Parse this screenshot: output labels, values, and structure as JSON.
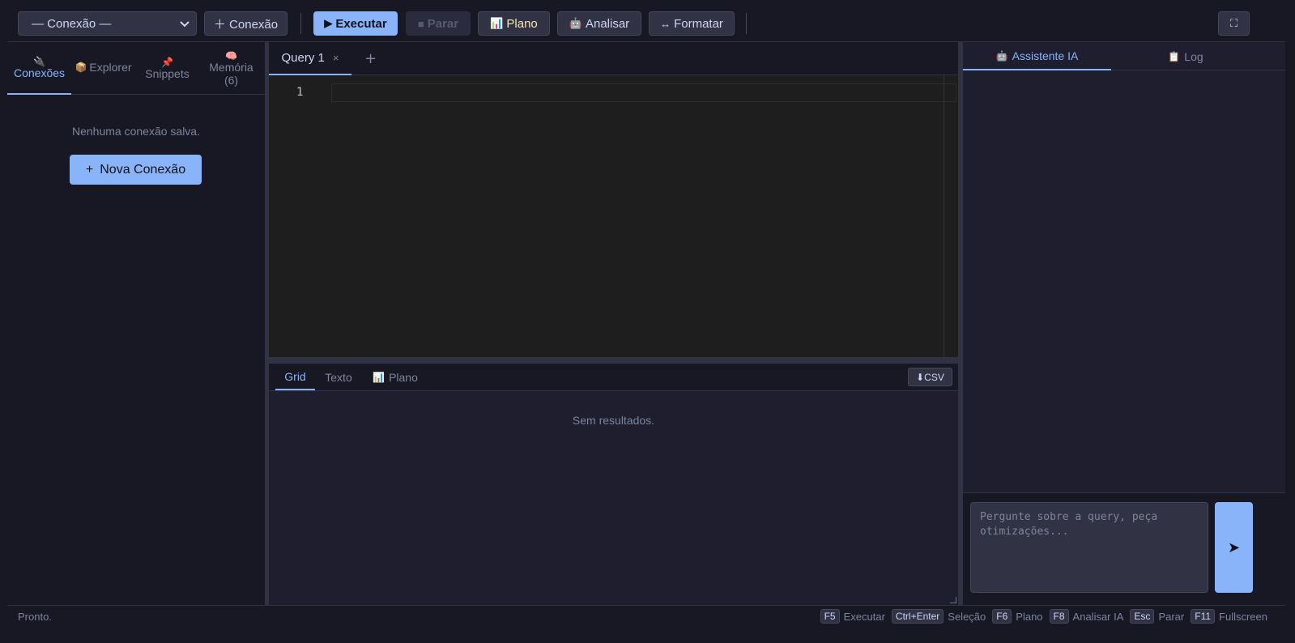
{
  "toolbar": {
    "connection_select": "— Conexão —",
    "add_connection": "＋ Conexão",
    "execute": "Executar",
    "execute_icon": "▶",
    "stop": "Parar",
    "stop_icon": "■",
    "plan": "Plano",
    "plan_icon": "📊",
    "analyze": "Analisar",
    "analyze_icon": "🤖",
    "format": "Formatar",
    "format_icon": "↔",
    "fullscreen_icon": "⛶"
  },
  "sidebar": {
    "tabs": [
      {
        "label": "Conexões",
        "icon": "🔌"
      },
      {
        "label": "Explorer",
        "icon": "📦"
      },
      {
        "label": "Snippets",
        "icon": "📌"
      },
      {
        "label": "Memória",
        "icon": "🧠",
        "count": "(6)"
      }
    ],
    "empty_message": "Nenhuma conexão salva.",
    "new_connection": "Nova Conexão",
    "new_connection_icon": "+"
  },
  "editor": {
    "tab_label": "Query 1",
    "tab_close": "×",
    "add_tab": "+",
    "line_number": "1"
  },
  "results": {
    "tabs": [
      {
        "label": "Grid"
      },
      {
        "label": "Texto"
      },
      {
        "label": "Plano",
        "icon": "📊"
      }
    ],
    "csv": "⬇CSV",
    "empty": "Sem resultados."
  },
  "assistant": {
    "tabs": [
      {
        "label": "Assistente IA",
        "icon": "🤖"
      },
      {
        "label": "Log",
        "icon": "📋"
      }
    ],
    "placeholder": "Pergunte sobre a query, peça otimizações...",
    "send_icon": "➤"
  },
  "status": {
    "text": "Pronto.",
    "shortcuts": [
      {
        "key": "F5",
        "label": "Executar"
      },
      {
        "key": "Ctrl+Enter",
        "label": "Seleção"
      },
      {
        "key": "F6",
        "label": "Plano"
      },
      {
        "key": "F8",
        "label": "Analisar IA"
      },
      {
        "key": "Esc",
        "label": "Parar"
      },
      {
        "key": "F11",
        "label": "Fullscreen"
      }
    ]
  },
  "colors": {
    "accent": "#89b4fa",
    "background": "#1e1e2e",
    "panel": "#181825",
    "editor": "#1e1e1e"
  }
}
